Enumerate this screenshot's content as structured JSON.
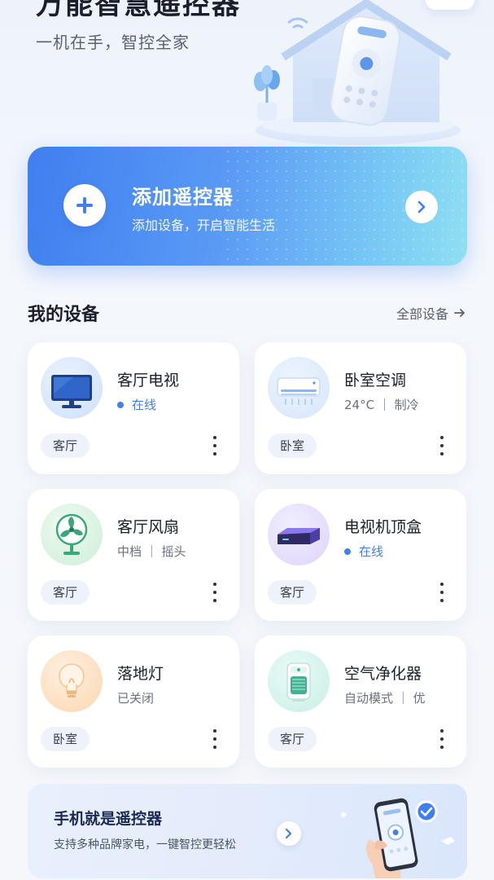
{
  "header": {
    "title": "万能智慧遥控器",
    "subtitle": "一机在手，智控全家"
  },
  "add_card": {
    "title": "添加遥控器",
    "subtitle": "添加设备，开启智能生活"
  },
  "devices_section": {
    "title": "我的设备",
    "view_all": "全部设备"
  },
  "devices": [
    {
      "name": "客厅电视",
      "status": "在线",
      "online": true,
      "room": "客厅",
      "icon": "tv-icon"
    },
    {
      "name": "卧室空调",
      "status": "24°C ｜ 制冷",
      "online": false,
      "room": "卧室",
      "icon": "air-conditioner-icon"
    },
    {
      "name": "客厅风扇",
      "status": "中档 ｜ 摇头",
      "online": false,
      "room": "客厅",
      "icon": "fan-icon"
    },
    {
      "name": "电视机顶盒",
      "status": "在线",
      "online": true,
      "room": "客厅",
      "icon": "set-top-box-icon"
    },
    {
      "name": "落地灯",
      "status": "已关闭",
      "online": false,
      "room": "卧室",
      "icon": "light-bulb-icon"
    },
    {
      "name": "空气净化器",
      "status": "自动模式 ｜ 优",
      "online": false,
      "room": "客厅",
      "icon": "air-purifier-icon"
    }
  ],
  "promo": {
    "title": "手机就是遥控器",
    "subtitle": "支持多种品牌家电，一键智控更轻松"
  },
  "colors": {
    "accent": "#3f7ff0",
    "online": "#3f7ff0"
  }
}
